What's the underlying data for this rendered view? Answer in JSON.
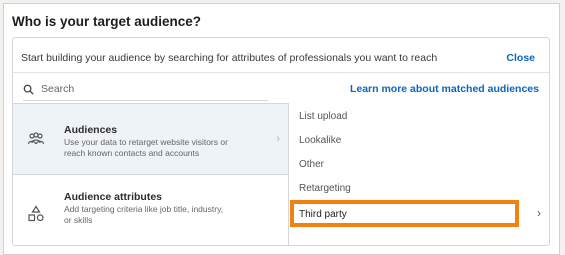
{
  "heading": "Who is your target audience?",
  "intro": "Start building your audience by searching for attributes of professionals you want to reach",
  "close_label": "Close",
  "search": {
    "placeholder": "Search",
    "icon": "search-icon"
  },
  "learn_more": "Learn more about matched audiences",
  "left_items": [
    {
      "title": "Audiences",
      "desc": "Use your data to retarget website visitors or reach known contacts and accounts",
      "icon": "people-group-icon",
      "chevron": "›"
    },
    {
      "title": "Audience attributes",
      "desc": "Add targeting criteria like job title, industry, or skills",
      "icon": "shapes-icon"
    }
  ],
  "right_items": [
    "List upload",
    "Lookalike",
    "Other",
    "Retargeting",
    "Third party"
  ],
  "right_chevron": "›",
  "colors": {
    "accent": "#0a66c2",
    "highlight": "#f2810f",
    "selected_bg": "#eef3f8"
  }
}
